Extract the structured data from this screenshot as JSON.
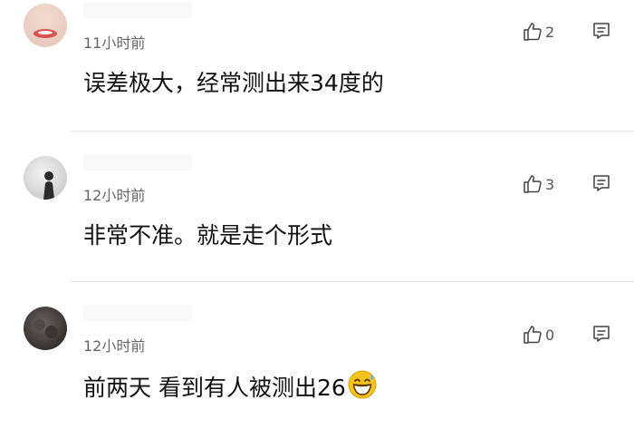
{
  "comments": [
    {
      "time": "11小时前",
      "likes": "2",
      "text": "误差极大，经常测出来34度的"
    },
    {
      "time": "12小时前",
      "likes": "3",
      "text": "非常不准。就是走个形式"
    },
    {
      "time": "12小时前",
      "likes": "0",
      "text": "前两天 看到有人被测出26",
      "emoji": "grinning-sweat-emoji"
    }
  ],
  "icons": {
    "like": "thumbs-up-icon",
    "reply": "comment-icon"
  },
  "colors": {
    "text": "#111111",
    "meta": "#666666",
    "icon": "#444444",
    "divider": "#e6e6e6",
    "emoji": "#f6c21c"
  }
}
